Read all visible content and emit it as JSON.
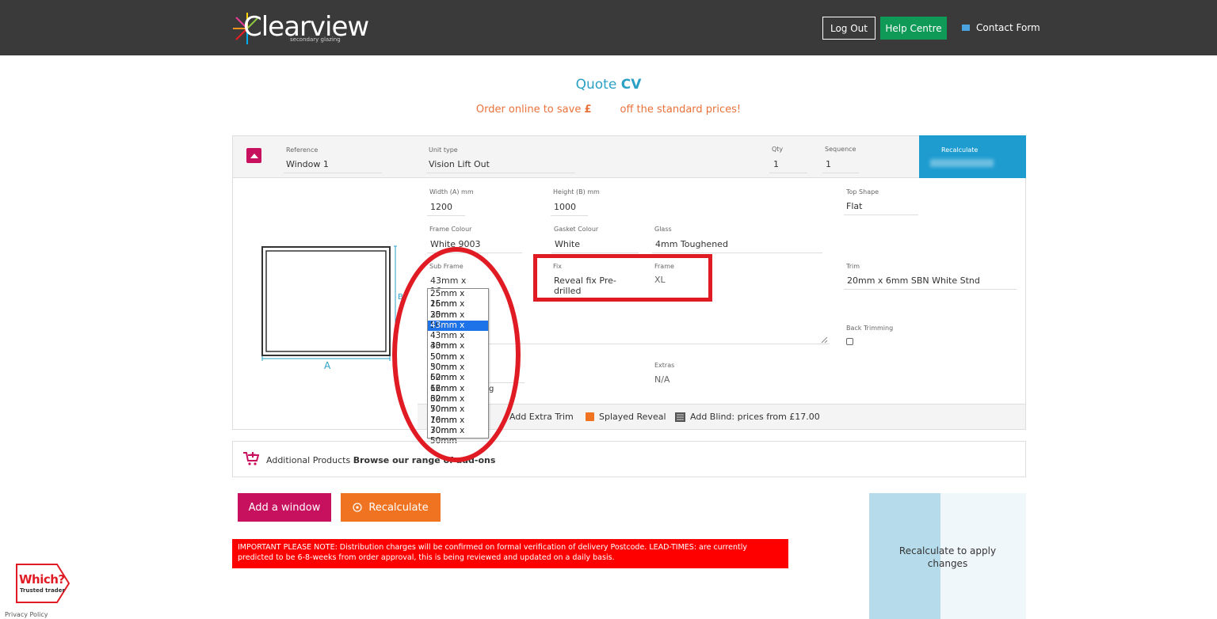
{
  "header": {
    "logo_text": "Clearview",
    "logo_sub": "secondary glazing",
    "logout": "Log Out",
    "help": "Help Centre",
    "contact": "Contact Form"
  },
  "quote": {
    "title_prefix": "Quote ",
    "title_bold": "CV",
    "save_prefix": "Order online to save ",
    "save_currency": "£",
    "save_suffix": "off the standard prices!"
  },
  "window": {
    "reference_label": "Reference",
    "reference": "Window 1",
    "unit_type_label": "Unit type",
    "unit_type": "Vision Lift Out",
    "qty_label": "Qty",
    "qty": "1",
    "sequence_label": "Sequence",
    "sequence": "1",
    "recalculate_label": "Recalculate",
    "width_label": "Width (A) mm",
    "width": "1200",
    "height_label": "Height (B) mm",
    "height": "1000",
    "top_shape_label": "Top Shape",
    "top_shape": "Flat",
    "frame_colour_label": "Frame Colour",
    "frame_colour": "White 9003",
    "gasket_colour_label": "Gasket Colour",
    "gasket_colour": "White",
    "glass_label": "Glass",
    "glass": "4mm Toughened",
    "sub_frame_label": "Sub Frame",
    "sub_frame": "43mm x 16mm",
    "fix_label": "Fix",
    "fix": "Reveal fix Pre-drilled",
    "frame_label": "Frame",
    "frame": "XL",
    "trim_label": "Trim",
    "trim": "20mm x 6mm SBN White Stnd",
    "back_trimming_label": "Back Trimming",
    "extras_label": "Extras",
    "extras": "N/A",
    "dim_a": "A",
    "dim_b": "B"
  },
  "subframe_options": [
    "25mm x 16mm",
    "25mm x 30mm",
    "25mm x 50mm",
    "43mm x 16mm",
    "43mm x 30mm",
    "43mm x 50mm",
    "50mm x 30mm",
    "50mm x 50mm",
    "62mm x 16mm",
    "62mm x 30mm",
    "62mm x 50mm",
    "70mm x 16mm",
    "70mm x 30mm",
    "70mm x 50mm"
  ],
  "toolbar": {
    "extra_trim": "Add Extra Trim",
    "splayed": "Splayed Reveal",
    "blind": "Add Blind: prices from £17.00"
  },
  "additional": {
    "label": "Additional Products",
    "link": "Browse our range of add-ons"
  },
  "actions": {
    "add_window": "Add a window",
    "recalculate": "Recalculate"
  },
  "notice": "IMPORTANT PLEASE NOTE: Distribution charges will be confirmed on formal verification of delivery Postcode. LEAD-TIMES: are currently predicted to be 6-8-weeks from order approval, this is being reviewed and updated on a daily basis.",
  "summary": {
    "message": "Recalculate to apply changes"
  },
  "footer": {
    "which_title": "Which?",
    "which_sub": "Trusted trader",
    "privacy": "Privacy Policy"
  }
}
